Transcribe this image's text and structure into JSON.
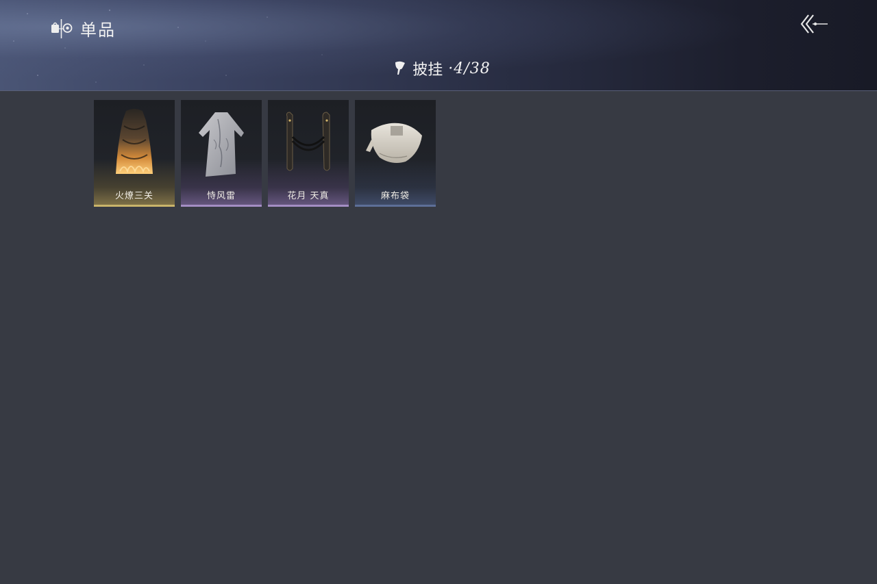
{
  "header": {
    "title": "单品",
    "category_icon": "closet-icon",
    "back_icon": "back-arrow-icon"
  },
  "section": {
    "icon": "cloak-icon",
    "label": "披挂",
    "count": "·4/38"
  },
  "items": [
    {
      "name": "火燎三关",
      "rarity_color": "#c9b46a",
      "icon": "flaming-cloak-icon"
    },
    {
      "name": "恃风雷",
      "rarity_color": "#a48ec4",
      "icon": "white-robe-icon"
    },
    {
      "name": "花月 天真",
      "rarity_color": "#a48ec4",
      "icon": "ribbon-drape-icon"
    },
    {
      "name": "麻布袋",
      "rarity_color": "#5d6f98",
      "icon": "cloth-sack-icon"
    }
  ]
}
